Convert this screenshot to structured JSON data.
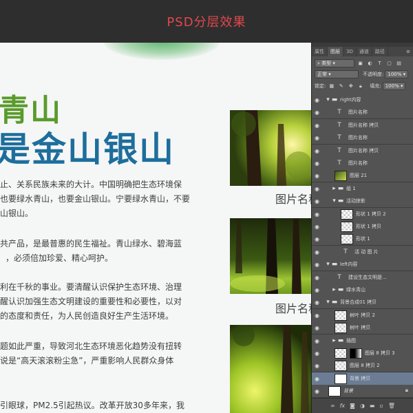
{
  "banner": {
    "title": "PSD分层效果"
  },
  "canvas": {
    "headline_line1": "青山",
    "headline_line2": "是金山银山",
    "paragraphs": [
      [
        "止、关系民族未来的大计。中国明确把生态环境保",
        "也要绿水青山，也要金山银山。宁要绿水青山，不要",
        "山银山。"
      ],
      [
        "共产品，是最普惠的民生福祉。青山绿水、碧海蓝",
        "，必须倍加珍爱、精心呵护。"
      ],
      [
        "利在千秋的事业。要清醒认识保护生态环境、治理",
        "醒认识加强生态文明建设的重要性和必要性，以对",
        "的态度和责任，为人民创造良好生产生活环境。"
      ],
      [
        "题如此严重，导致河北生态环境恶化趋势没有扭转",
        "说是“高天滚滚粉尘急”，严重影响人民群众身体"
      ],
      [
        "引眼球，PM2.5引起热议。改革开放30多年来，我"
      ]
    ],
    "captions": [
      "图片名称",
      "图片名称"
    ]
  },
  "layers_panel": {
    "tabs": [
      "属性",
      "图层",
      "3D",
      "通道",
      "路径"
    ],
    "active_tab": "图层",
    "kind_filter": "类型",
    "blend_mode": "正常",
    "opacity_label": "不透明度:",
    "opacity_value": "100%",
    "lock_label": "锁定:",
    "fill_label": "填充:",
    "fill_value": "100%",
    "layers": [
      {
        "name": "right内容",
        "kind": "group",
        "indent": 0,
        "expanded": true
      },
      {
        "name": "图片名称",
        "kind": "text",
        "indent": 1
      },
      {
        "name": "图片名称 拷贝",
        "kind": "text",
        "indent": 1
      },
      {
        "name": "图片名称",
        "kind": "text",
        "indent": 1
      },
      {
        "name": "图片名称 拷贝",
        "kind": "text",
        "indent": 1
      },
      {
        "name": "图片名称",
        "kind": "text",
        "indent": 1
      },
      {
        "name": "图层 21",
        "kind": "photo",
        "indent": 1
      },
      {
        "name": "组 1",
        "kind": "group",
        "indent": 1,
        "expanded": false
      },
      {
        "name": "活动掠影",
        "kind": "group",
        "indent": 1,
        "expanded": true
      },
      {
        "name": "形状 1 拷贝 2",
        "kind": "shape",
        "indent": 2
      },
      {
        "name": "形状 1 拷贝",
        "kind": "shape",
        "indent": 2
      },
      {
        "name": "形状 1",
        "kind": "shape",
        "indent": 2
      },
      {
        "name": "活 动 图 片",
        "kind": "text",
        "indent": 2
      },
      {
        "name": "left内容",
        "kind": "group",
        "indent": 0,
        "expanded": true
      },
      {
        "name": "建设生态文明是...",
        "kind": "text",
        "indent": 1
      },
      {
        "name": "绿水青山",
        "kind": "group",
        "indent": 1,
        "expanded": false
      },
      {
        "name": "背景合成01 拷贝",
        "kind": "group",
        "indent": 0,
        "expanded": true
      },
      {
        "name": "树叶 拷贝 2",
        "kind": "shape",
        "indent": 1
      },
      {
        "name": "树叶 拷贝",
        "kind": "shape",
        "indent": 1
      },
      {
        "name": "插图",
        "kind": "group",
        "indent": 1,
        "expanded": false
      },
      {
        "name": "图层 8 拷贝 3",
        "kind": "masked",
        "indent": 1
      },
      {
        "name": "图层 8 拷贝 2",
        "kind": "shape",
        "indent": 1
      },
      {
        "name": "背景 拷贝",
        "kind": "white",
        "indent": 1,
        "selected": true
      },
      {
        "name": "背景",
        "kind": "background",
        "indent": 0,
        "locked": true
      }
    ],
    "bottom_icons": [
      "link-icon",
      "fx-icon",
      "mask-icon",
      "adjustment-icon",
      "folder-icon",
      "new-layer-icon",
      "trash-icon"
    ]
  }
}
